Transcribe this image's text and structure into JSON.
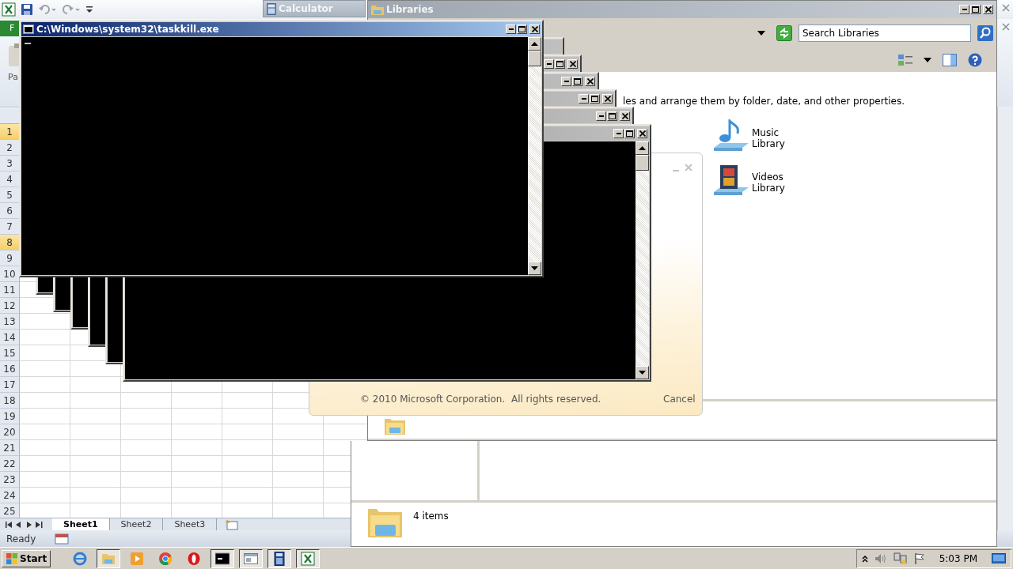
{
  "excel": {
    "file_tab": "F",
    "paste_label": "Pa",
    "row_numbers": [
      {
        "label": "1",
        "selected": true
      },
      {
        "label": "2",
        "selected": false
      },
      {
        "label": "3",
        "selected": false
      },
      {
        "label": "4",
        "selected": false
      },
      {
        "label": "5",
        "selected": false
      },
      {
        "label": "6",
        "selected": false
      },
      {
        "label": "7",
        "selected": false
      },
      {
        "label": "8",
        "selected": true
      },
      {
        "label": "9",
        "selected": false
      },
      {
        "label": "10",
        "selected": false
      },
      {
        "label": "11",
        "selected": false
      },
      {
        "label": "12",
        "selected": false
      },
      {
        "label": "13",
        "selected": false
      },
      {
        "label": "14",
        "selected": false
      },
      {
        "label": "15",
        "selected": false
      },
      {
        "label": "16",
        "selected": false
      },
      {
        "label": "17",
        "selected": false
      },
      {
        "label": "18",
        "selected": false
      },
      {
        "label": "19",
        "selected": false
      },
      {
        "label": "20",
        "selected": false
      },
      {
        "label": "21",
        "selected": false
      },
      {
        "label": "22",
        "selected": false
      },
      {
        "label": "23",
        "selected": false
      },
      {
        "label": "24",
        "selected": false
      },
      {
        "label": "25",
        "selected": false
      }
    ],
    "sheet_tabs": [
      {
        "label": "Sheet1",
        "selected": true
      },
      {
        "label": "Sheet2",
        "selected": false
      },
      {
        "label": "Sheet3",
        "selected": false
      }
    ],
    "status": "Ready"
  },
  "calculator": {
    "title": "Calculator"
  },
  "explorer": {
    "title": "Libraries",
    "search_placeholder": "Search Libraries",
    "description": "les and arrange them by folder, date, and other properties.",
    "libraries": [
      {
        "name": "Music Library",
        "kind": "music"
      },
      {
        "name": "Videos Library",
        "kind": "videos"
      }
    ],
    "status": "4 items"
  },
  "splash": {
    "copyright": "© 2010 Microsoft Corporation.  All rights reserved.",
    "cancel": "Cancel"
  },
  "console": {
    "title": "C:\\Windows\\system32\\taskkill.exe"
  },
  "taskbar": {
    "start": "Start",
    "clock": "5:03 PM"
  }
}
